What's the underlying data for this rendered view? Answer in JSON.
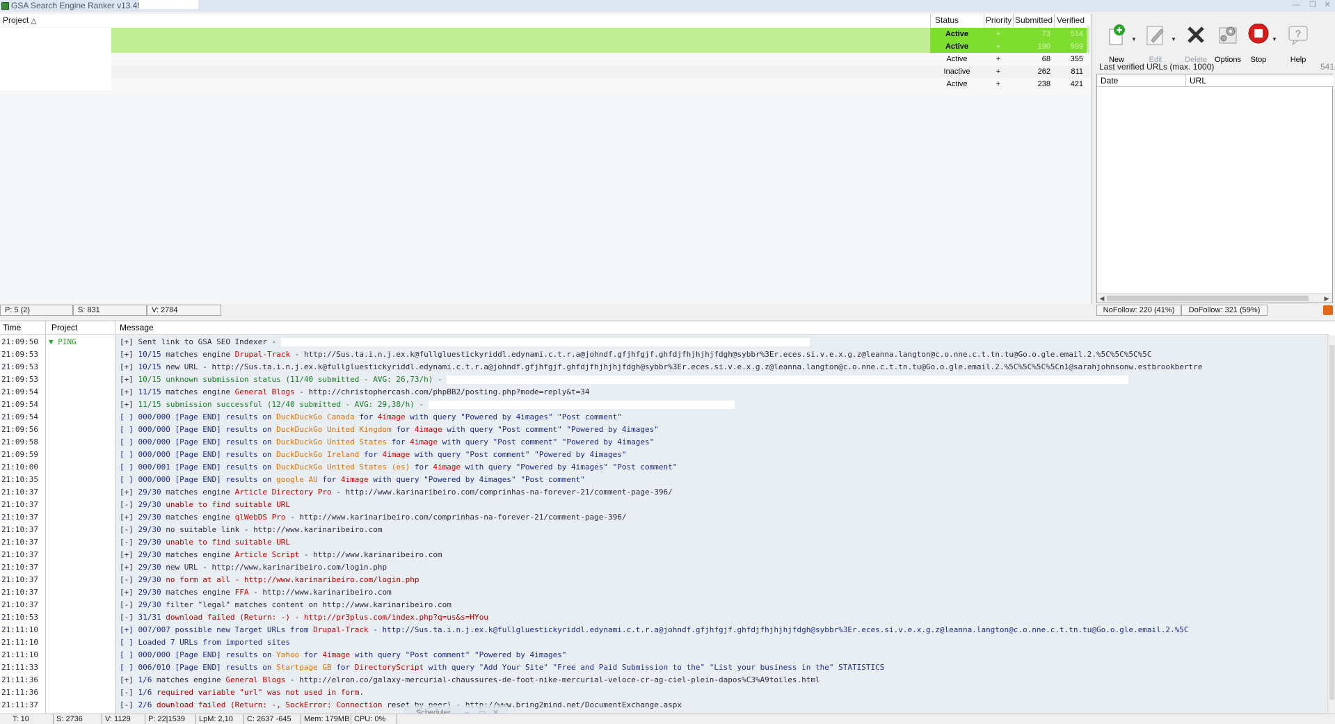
{
  "window": {
    "title": "GSA Search Engine Ranker v13.49 -",
    "buttons": [
      "—",
      "❐",
      "✕"
    ]
  },
  "projects": {
    "headers": {
      "project": "Project",
      "status": "Status",
      "priority": "Priority",
      "submitted": "Submitted",
      "verified": "Verified"
    },
    "rows": [
      {
        "status": "Active",
        "priority": "+",
        "submitted": "73",
        "verified": "514",
        "highlight": "bright"
      },
      {
        "status": "Active",
        "priority": "+",
        "submitted": "190",
        "verified": "599",
        "highlight": "bright"
      },
      {
        "status": "Active",
        "priority": "+",
        "submitted": "68",
        "verified": "355",
        "highlight": "none"
      },
      {
        "status": "Inactive",
        "priority": "+",
        "submitted": "262",
        "verified": "811",
        "highlight": "none"
      },
      {
        "status": "Active",
        "priority": "+",
        "submitted": "238",
        "verified": "421",
        "highlight": "none"
      }
    ],
    "footer": {
      "p": "P: 5 (2)",
      "s": "S: 831",
      "v": "V: 2784"
    }
  },
  "toolbar": {
    "new": "New",
    "edit": "Edit",
    "delete": "Delete",
    "options": "Options",
    "stop": "Stop",
    "help": "Help"
  },
  "verified_panel": {
    "label": "Last verified URLs (max. 1000)",
    "count": "541",
    "col_date": "Date",
    "col_url": "URL",
    "nofollow": "NoFollow: 220 (41%)",
    "dofollow": "DoFollow: 321 (59%)"
  },
  "log": {
    "headers": {
      "time": "Time",
      "project": "Project",
      "message": "Message"
    },
    "project_tag": "▼ PING",
    "rows": [
      {
        "time": "21:09:50",
        "parts": [
          {
            "t": "[+] Sent link to GSA SEO Indexer - ",
            "c": "m-dark"
          }
        ],
        "redact": 760
      },
      {
        "time": "21:09:53",
        "parts": [
          {
            "t": "[+] ",
            "c": "m-dark"
          },
          {
            "t": "10/15",
            "c": "m-blue"
          },
          {
            "t": " matches engine ",
            "c": "m-dark"
          },
          {
            "t": "Drupal-Track",
            "c": "e-red"
          },
          {
            "t": " - http://Sus.ta.i.n.j.ex.k@fullgluestickyriddl.edynami.c.t.r.a@johndf.gfjhfgjf.ghfdjfhjhjhjfdgh@sybbr%3Er.eces.si.v.e.x.g.z@leanna.langton@c.o.nne.c.t.tn.tu@Go.o.gle.email.2.%5C%5C%5C%5C",
            "c": "m-dark"
          }
        ]
      },
      {
        "time": "21:09:53",
        "parts": [
          {
            "t": "[+] ",
            "c": "m-dark"
          },
          {
            "t": "10/15",
            "c": "m-blue"
          },
          {
            "t": " new URL - http://Sus.ta.i.n.j.ex.k@fullgluestickyriddl.edynami.c.t.r.a@johndf.gfjhfgjf.ghfdjfhjhjhjfdgh@sybbr%3Er.eces.si.v.e.x.g.z@leanna.langton@c.o.nne.c.t.tn.tu@Go.o.gle.email.2.%5C%5C%5C%5Cn1@sarahjohnsonw.estbrookbertre",
            "c": "m-dark"
          }
        ]
      },
      {
        "time": "21:09:53",
        "parts": [
          {
            "t": "[+] ",
            "c": "m-dark"
          },
          {
            "t": "10/15 unknown submission status (11/40 submitted - AVG: 26,73/h) - ",
            "c": "m-green"
          }
        ],
        "redact": 980
      },
      {
        "time": "21:09:54",
        "parts": [
          {
            "t": "[+] ",
            "c": "m-dark"
          },
          {
            "t": "11/15",
            "c": "m-blue"
          },
          {
            "t": " matches engine ",
            "c": "m-dark"
          },
          {
            "t": "General Blogs",
            "c": "e-red"
          },
          {
            "t": " - http://christophercash.com/phpBB2/posting.php?mode=reply&t=34",
            "c": "m-dark"
          }
        ]
      },
      {
        "time": "21:09:54",
        "parts": [
          {
            "t": "[+] ",
            "c": "m-dark"
          },
          {
            "t": "11/15 submission successful (12/40 submitted - AVG: 29,38/h) - ",
            "c": "m-green"
          }
        ],
        "redact": 440
      },
      {
        "time": "21:09:54",
        "parts": [
          {
            "t": "[ ] 000/000 [Page END] results on ",
            "c": "m-blue"
          },
          {
            "t": "DuckDuckGo Canada",
            "c": "e-orange"
          },
          {
            "t": " for ",
            "c": "m-blue"
          },
          {
            "t": "4image",
            "c": "e-red"
          },
          {
            "t": " with query \"Powered by 4images\" \"Post comment\"",
            "c": "m-blue"
          }
        ]
      },
      {
        "time": "21:09:56",
        "parts": [
          {
            "t": "[ ] 000/000 [Page END] results on ",
            "c": "m-blue"
          },
          {
            "t": "DuckDuckGo United Kingdom",
            "c": "e-orange"
          },
          {
            "t": " for ",
            "c": "m-blue"
          },
          {
            "t": "4image",
            "c": "e-red"
          },
          {
            "t": " with query \"Post comment\" \"Powered by 4images\"",
            "c": "m-blue"
          }
        ]
      },
      {
        "time": "21:09:58",
        "parts": [
          {
            "t": "[ ] 000/000 [Page END] results on ",
            "c": "m-blue"
          },
          {
            "t": "DuckDuckGo United States",
            "c": "e-orange"
          },
          {
            "t": " for ",
            "c": "m-blue"
          },
          {
            "t": "4image",
            "c": "e-red"
          },
          {
            "t": " with query \"Post comment\" \"Powered by 4images\"",
            "c": "m-blue"
          }
        ]
      },
      {
        "time": "21:09:59",
        "parts": [
          {
            "t": "[ ] 000/000 [Page END] results on ",
            "c": "m-blue"
          },
          {
            "t": "DuckDuckGo Ireland",
            "c": "e-orange"
          },
          {
            "t": " for ",
            "c": "m-blue"
          },
          {
            "t": "4image",
            "c": "e-red"
          },
          {
            "t": " with query \"Post comment\" \"Powered by 4images\"",
            "c": "m-blue"
          }
        ]
      },
      {
        "time": "21:10:00",
        "parts": [
          {
            "t": "[ ] 000/001 [Page END] results on ",
            "c": "m-blue"
          },
          {
            "t": "DuckDuckGo United States (es)",
            "c": "e-orange"
          },
          {
            "t": " for ",
            "c": "m-blue"
          },
          {
            "t": "4image",
            "c": "e-red"
          },
          {
            "t": " with query \"Powered by 4images\" \"Post comment\"",
            "c": "m-blue"
          }
        ]
      },
      {
        "time": "21:10:35",
        "parts": [
          {
            "t": "[ ] 000/000 [Page END] results on ",
            "c": "m-blue"
          },
          {
            "t": "google AU",
            "c": "e-orange"
          },
          {
            "t": " for ",
            "c": "m-blue"
          },
          {
            "t": "4image",
            "c": "e-red"
          },
          {
            "t": " with query \"Powered by 4images\" \"Post comment\"",
            "c": "m-blue"
          }
        ]
      },
      {
        "time": "21:10:37",
        "parts": [
          {
            "t": "[+] ",
            "c": "m-dark"
          },
          {
            "t": "29/30",
            "c": "m-blue"
          },
          {
            "t": " matches engine ",
            "c": "m-dark"
          },
          {
            "t": "Article Directory Pro",
            "c": "e-red"
          },
          {
            "t": " - http://www.karinaribeiro.com/comprinhas-na-forever-21/comment-page-396/",
            "c": "m-dark"
          }
        ]
      },
      {
        "time": "21:10:37",
        "parts": [
          {
            "t": "[-] ",
            "c": "m-dark"
          },
          {
            "t": "29/30",
            "c": "m-blue"
          },
          {
            "t": " unable to find suitable URL",
            "c": "m-red"
          }
        ]
      },
      {
        "time": "21:10:37",
        "parts": [
          {
            "t": "[+] ",
            "c": "m-dark"
          },
          {
            "t": "29/30",
            "c": "m-blue"
          },
          {
            "t": " matches engine ",
            "c": "m-dark"
          },
          {
            "t": "qlWebDS Pro",
            "c": "e-red"
          },
          {
            "t": " - http://www.karinaribeiro.com/comprinhas-na-forever-21/comment-page-396/",
            "c": "m-dark"
          }
        ]
      },
      {
        "time": "21:10:37",
        "parts": [
          {
            "t": "[-] ",
            "c": "m-dark"
          },
          {
            "t": "29/30",
            "c": "m-blue"
          },
          {
            "t": " no suitable link - http://www.karinaribeiro.com",
            "c": "m-dark"
          }
        ]
      },
      {
        "time": "21:10:37",
        "parts": [
          {
            "t": "[-] ",
            "c": "m-dark"
          },
          {
            "t": "29/30",
            "c": "m-blue"
          },
          {
            "t": " unable to find suitable URL",
            "c": "m-red"
          }
        ]
      },
      {
        "time": "21:10:37",
        "parts": [
          {
            "t": "[+] ",
            "c": "m-dark"
          },
          {
            "t": "29/30",
            "c": "m-blue"
          },
          {
            "t": " matches engine ",
            "c": "m-dark"
          },
          {
            "t": "Article Script",
            "c": "e-red"
          },
          {
            "t": " - http://www.karinaribeiro.com",
            "c": "m-dark"
          }
        ]
      },
      {
        "time": "21:10:37",
        "parts": [
          {
            "t": "[+] ",
            "c": "m-dark"
          },
          {
            "t": "29/30",
            "c": "m-blue"
          },
          {
            "t": " new URL - http://www.karinaribeiro.com/login.php",
            "c": "m-dark"
          }
        ]
      },
      {
        "time": "21:10:37",
        "parts": [
          {
            "t": "[-] ",
            "c": "m-dark"
          },
          {
            "t": "29/30",
            "c": "m-blue"
          },
          {
            "t": " no form at all - http://www.karinaribeiro.com/login.php",
            "c": "m-red"
          }
        ]
      },
      {
        "time": "21:10:37",
        "parts": [
          {
            "t": "[+] ",
            "c": "m-dark"
          },
          {
            "t": "29/30",
            "c": "m-blue"
          },
          {
            "t": " matches engine ",
            "c": "m-dark"
          },
          {
            "t": "FFA",
            "c": "e-red"
          },
          {
            "t": " - http://www.karinaribeiro.com",
            "c": "m-dark"
          }
        ]
      },
      {
        "time": "21:10:37",
        "parts": [
          {
            "t": "[-] ",
            "c": "m-dark"
          },
          {
            "t": "29/30",
            "c": "m-blue"
          },
          {
            "t": " filter \"legal\" matches content on http://www.karinaribeiro.com",
            "c": "m-dark"
          }
        ]
      },
      {
        "time": "21:10:53",
        "parts": [
          {
            "t": "[-] ",
            "c": "m-dark"
          },
          {
            "t": "31/31",
            "c": "m-blue"
          },
          {
            "t": " download failed (Return: -) - http://pr3plus.com/index.php?q=us&s=HYou",
            "c": "m-red"
          }
        ]
      },
      {
        "time": "21:11:10",
        "parts": [
          {
            "t": "[+] 007/007 possible new Target URLs from ",
            "c": "m-blue"
          },
          {
            "t": "Drupal-Track",
            "c": "e-red"
          },
          {
            "t": " - http://Sus.ta.i.n.j.ex.k@fullgluestickyriddl.edynami.c.t.r.a@johndf.gfjhfgjf.ghfdjfhjhjhjfdgh@sybbr%3Er.eces.si.v.e.x.g.z@leanna.langton@c.o.nne.c.t.tn.tu@Go.o.gle.email.2.%5C",
            "c": "m-blue"
          }
        ]
      },
      {
        "time": "21:11:10",
        "parts": [
          {
            "t": "[ ] Loaded 7 URLs from imported sites",
            "c": "m-blue"
          }
        ]
      },
      {
        "time": "21:11:10",
        "parts": [
          {
            "t": "[ ] 000/000 [Page END] results on ",
            "c": "m-blue"
          },
          {
            "t": "Yahoo",
            "c": "e-orange"
          },
          {
            "t": " for ",
            "c": "m-blue"
          },
          {
            "t": "4image",
            "c": "e-red"
          },
          {
            "t": " with query \"Post comment\" \"Powered by 4images\"",
            "c": "m-blue"
          }
        ]
      },
      {
        "time": "21:11:33",
        "parts": [
          {
            "t": "[ ] 006/010 [Page END] results on ",
            "c": "m-blue"
          },
          {
            "t": "Startpage GB",
            "c": "e-orange"
          },
          {
            "t": " for ",
            "c": "m-blue"
          },
          {
            "t": "DirectoryScript",
            "c": "e-red"
          },
          {
            "t": " with query \"Add Your Site\" \"Free and Paid Submission to the\" \"List your business in the\" STATISTICS",
            "c": "m-blue"
          }
        ]
      },
      {
        "time": "21:11:36",
        "parts": [
          {
            "t": "[+] ",
            "c": "m-dark"
          },
          {
            "t": "1/6",
            "c": "m-blue"
          },
          {
            "t": " matches engine ",
            "c": "m-dark"
          },
          {
            "t": "General Blogs",
            "c": "e-red"
          },
          {
            "t": " - http://elron.co/galaxy-mercurial-chaussures-de-foot-nike-mercurial-veloce-cr-ag-ciel-plein-dapos%C3%A9toiles.html",
            "c": "m-dark"
          }
        ]
      },
      {
        "time": "21:11:36",
        "parts": [
          {
            "t": "[-] ",
            "c": "m-dark"
          },
          {
            "t": "1/6",
            "c": "m-blue"
          },
          {
            "t": " required variable \"url\" was not used in form.",
            "c": "m-red"
          }
        ]
      },
      {
        "time": "21:11:37",
        "parts": [
          {
            "t": "[-] ",
            "c": "m-dark"
          },
          {
            "t": "2/6",
            "c": "m-blue"
          },
          {
            "t": " download failed (Return: -, SockError: Connection ",
            "c": "m-red"
          },
          {
            "t": "reset by peer) - http://www.bring2mind.net/DocumentExchange.aspx",
            "c": "m-dark"
          }
        ]
      }
    ]
  },
  "statusbar": {
    "t": "T: 10",
    "s": "S: 2736",
    "v": "V: 1129",
    "p": "P: 22|1539",
    "lpm": "LpM: 2,10",
    "c": "C: 2637 -645",
    "mem": "Mem: 179MB",
    "cpu": "CPU: 0%"
  },
  "scheduler": {
    "label": "Scheduler"
  }
}
